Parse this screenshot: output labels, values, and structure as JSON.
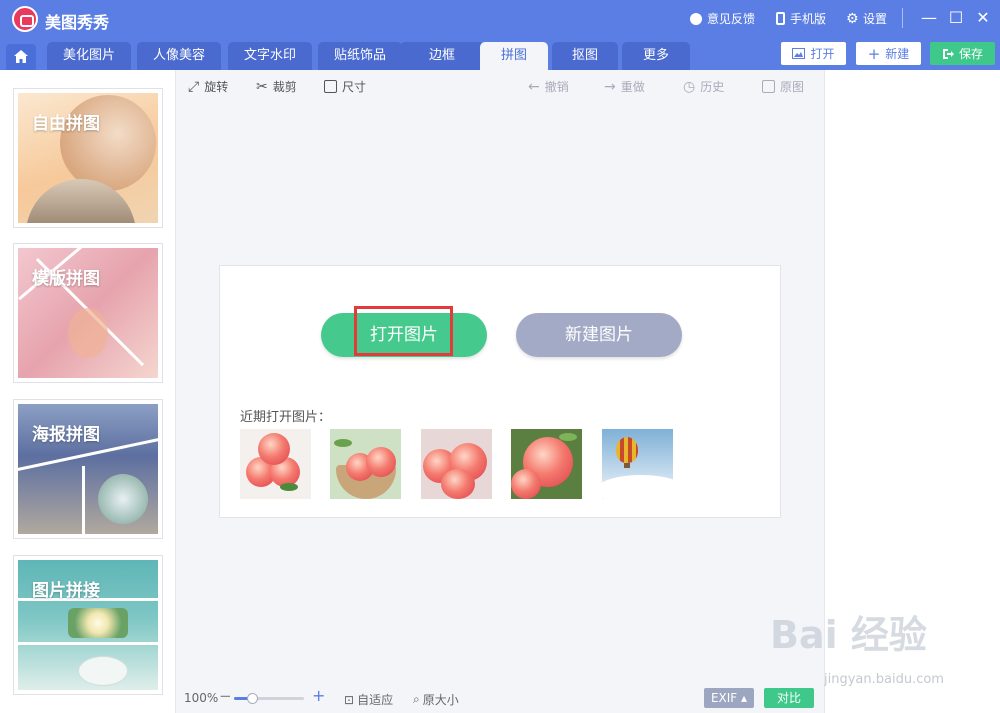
{
  "app": {
    "title": "美图秀秀"
  },
  "titlebar": {
    "feedback": "意见反馈",
    "mobile": "手机版",
    "settings": "设置",
    "minimize": "—",
    "maximize": "☐",
    "close": "✕"
  },
  "tabs": [
    {
      "label": "美化图片"
    },
    {
      "label": "人像美容"
    },
    {
      "label": "文字水印"
    },
    {
      "label": "贴纸饰品"
    },
    {
      "label": "边框"
    },
    {
      "label": "拼图"
    },
    {
      "label": "抠图"
    },
    {
      "label": "更多"
    }
  ],
  "active_tab": "拼图",
  "actions": {
    "open": "打开",
    "new": "新建",
    "save": "保存"
  },
  "sidebar": {
    "items": [
      {
        "label": "自由拼图"
      },
      {
        "label": "模版拼图"
      },
      {
        "label": "海报拼图"
      },
      {
        "label": "图片拼接"
      }
    ]
  },
  "toolbar": {
    "rotate": "旋转",
    "crop": "裁剪",
    "size": "尺寸",
    "undo": "撤销",
    "redo": "重做",
    "history": "历史",
    "original": "原图"
  },
  "main": {
    "open_image": "打开图片",
    "new_image": "新建图片",
    "recent_label": "近期打开图片："
  },
  "status": {
    "zoom": "100%",
    "zoom_level": 0.25,
    "fit": "自适应",
    "original_size": "原大小",
    "exif": "EXIF ▴",
    "compare": "对比"
  },
  "watermark": {
    "brand": "Bai 经验",
    "url": "jingyan.baidu.com"
  },
  "colors": {
    "header": "#5b7ee5",
    "accent_green": "#3ec98a",
    "new_button": "#a2aac6",
    "highlight": "#e43a3a"
  }
}
